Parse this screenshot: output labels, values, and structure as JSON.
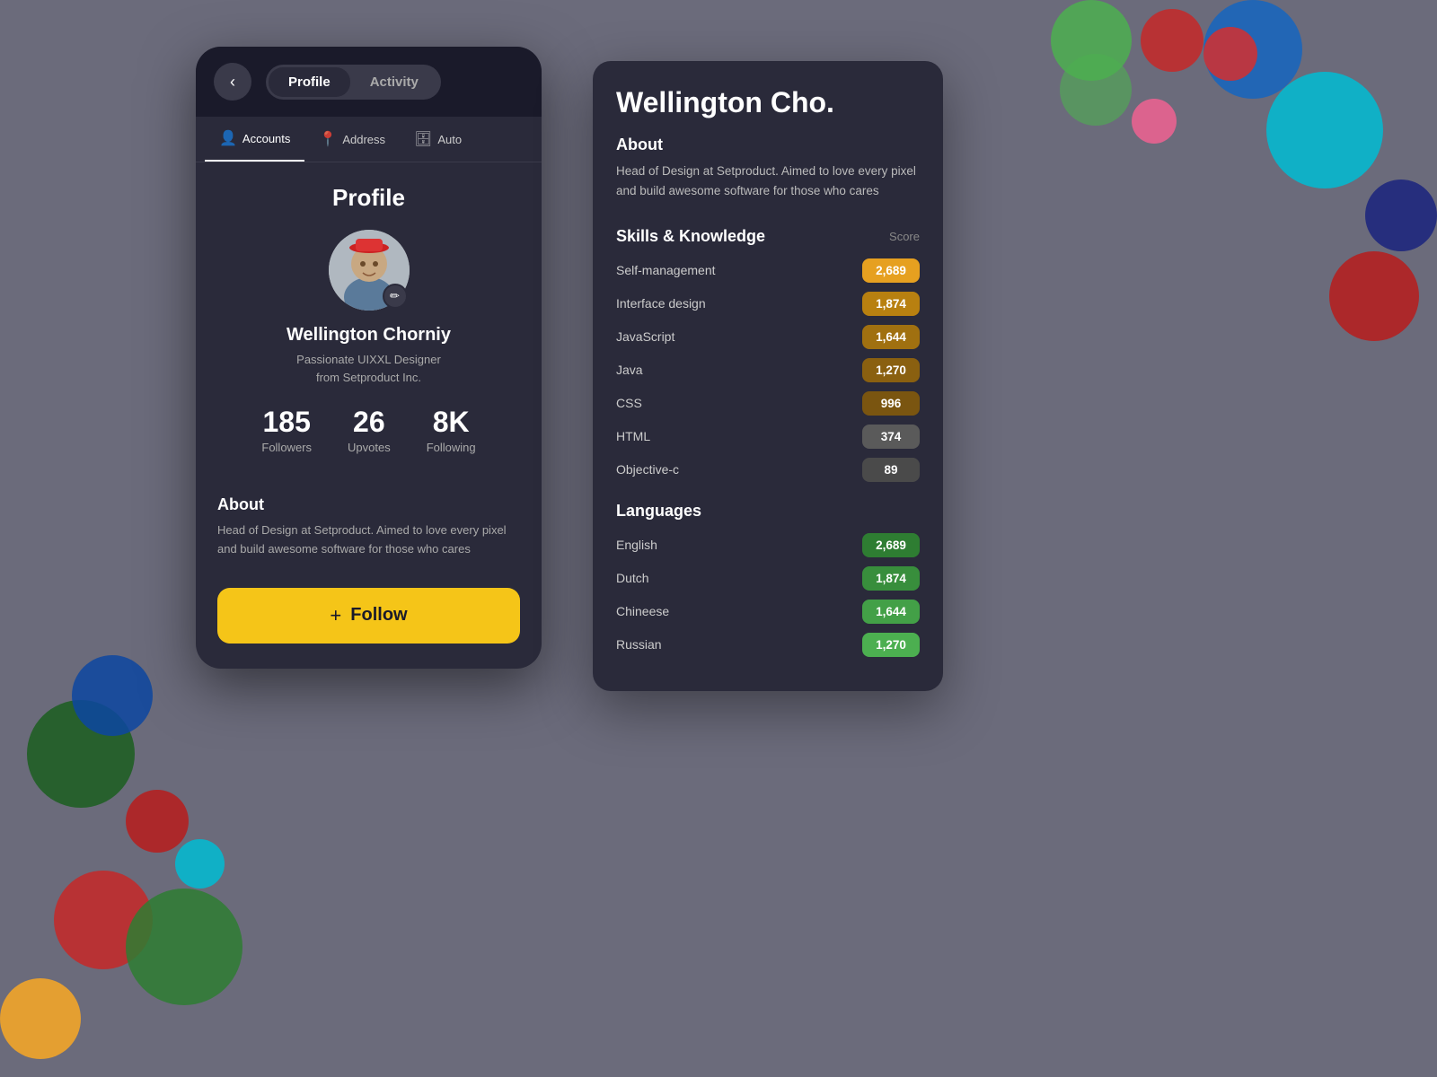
{
  "background_color": "#6b6b7b",
  "header": {
    "back_icon": "‹",
    "tabs": [
      {
        "label": "Profile",
        "active": true
      },
      {
        "label": "Activity",
        "active": false
      }
    ]
  },
  "nav_tabs": [
    {
      "label": "Accounts",
      "icon": "👤",
      "active": true
    },
    {
      "label": "Address",
      "icon": "📍",
      "active": false
    },
    {
      "label": "Auto",
      "icon": "🗄",
      "active": false
    }
  ],
  "profile": {
    "title": "Profile",
    "name": "Wellington Chorniy",
    "bio_line1": "Passionate UIXXL Designer",
    "bio_line2": "from Setproduct Inc.",
    "stats": [
      {
        "value": "185",
        "label": "Followers"
      },
      {
        "value": "26",
        "label": "Upvotes"
      },
      {
        "value": "8K",
        "label": "Following"
      }
    ],
    "about_title": "About",
    "about_text": "Head of Design at Setproduct. Aimed to love every pixel and build awesome software for those who cares",
    "follow_btn": {
      "plus": "+",
      "label": "Follow"
    }
  },
  "right_panel": {
    "username": "Wellington Cho.",
    "about_title": "About",
    "about_text": "Head of Design at Setproduct. Aimed to love every pixel and build awesome software for those who cares",
    "skills_title": "Skills & Knowledge",
    "score_label": "Score",
    "skills": [
      {
        "name": "Self-management",
        "score": "2,689",
        "color": "#e6a020",
        "width_pct": 100
      },
      {
        "name": "Interface design",
        "score": "1,874",
        "color": "#b88010",
        "width_pct": 70
      },
      {
        "name": "JavaScript",
        "score": "1,644",
        "color": "#a07010",
        "width_pct": 61
      },
      {
        "name": "Java",
        "score": "1,270",
        "color": "#8a6010",
        "width_pct": 47
      },
      {
        "name": "CSS",
        "score": "996",
        "color": "#7a5510",
        "width_pct": 37
      },
      {
        "name": "HTML",
        "score": "374",
        "color": "#5a5a5a",
        "width_pct": 14
      },
      {
        "name": "Objective-c",
        "score": "89",
        "color": "#4a4a4a",
        "width_pct": 3
      }
    ],
    "languages_title": "Languages",
    "languages": [
      {
        "name": "English",
        "score": "2,689",
        "color": "#2e7d32"
      },
      {
        "name": "Dutch",
        "score": "1,874",
        "color": "#388e3c"
      },
      {
        "name": "Chineese",
        "score": "1,644",
        "color": "#43a047"
      },
      {
        "name": "Russian",
        "score": "1,270",
        "color": "#4caf50"
      }
    ]
  },
  "edit_icon": "✏"
}
